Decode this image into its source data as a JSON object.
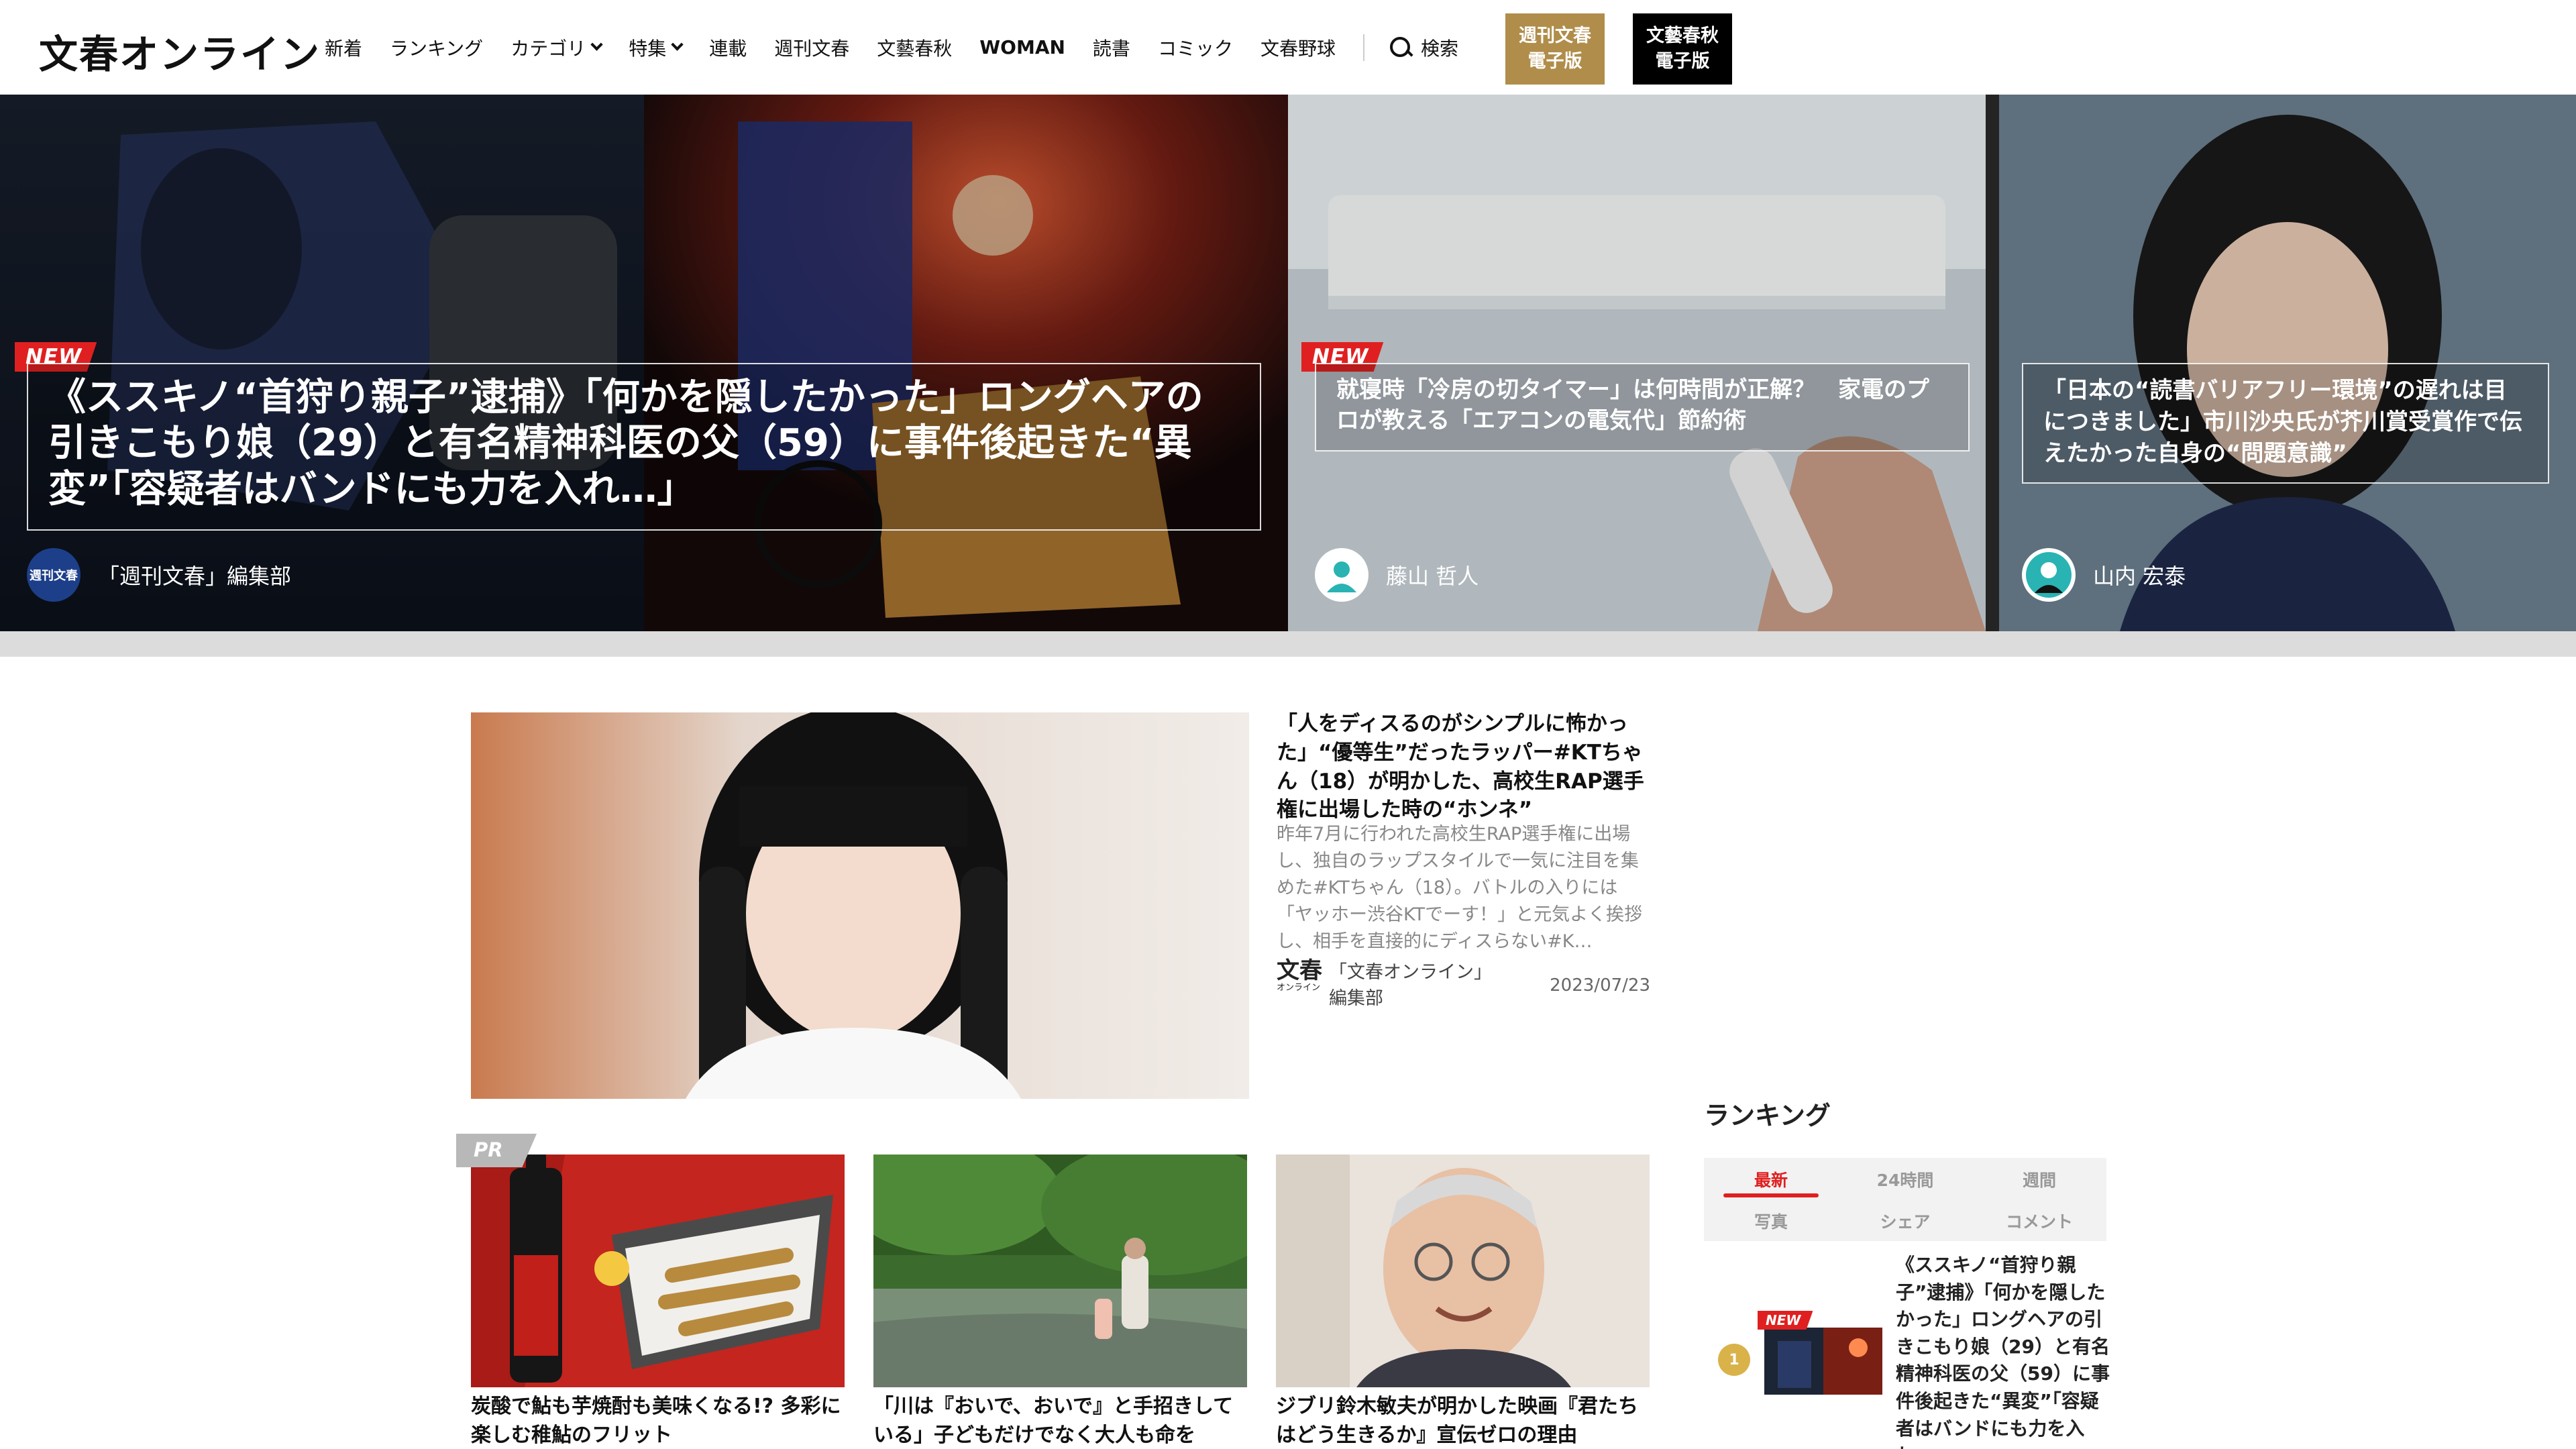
{
  "header": {
    "logo": "文春オンライン",
    "nav": [
      {
        "label": "新着"
      },
      {
        "label": "ランキング"
      },
      {
        "label": "カテゴリ"
      },
      {
        "label": "特集"
      },
      {
        "label": "連載"
      },
      {
        "label": "週刊文春"
      },
      {
        "label": "文藝春秋"
      },
      {
        "label": "WOMAN"
      },
      {
        "label": "読書"
      },
      {
        "label": "コミック"
      },
      {
        "label": "文春野球"
      }
    ],
    "search_label": "検索",
    "weekly_button": "週刊文春\n電子版",
    "bunshun_button": "文藝春秋\n電子版"
  },
  "hero": {
    "new_label": "NEW",
    "main": {
      "title": "《ススキノ“首狩り親子”逮捕》「何かを隠したかった」ロングヘアの引きこもり娘（29）と有名精神科医の父（59）に事件後起きた“異変”「容疑者はバンドにも力を入れ…」",
      "author": "「週刊文春」編集部",
      "avatar_text": "週刊文春"
    },
    "second": {
      "title": "就寝時「冷房の切タイマー」は何時間が正解？　家電のプロが教える「エアコンの電気代」節約術",
      "author": "藤山 哲人"
    },
    "third": {
      "title": "「日本の“読書バリアフリー環境”の遅れは目につきました」市川沙央氏が芥川賞受賞作で伝えたかった自身の“問題意識”",
      "author": "山内 宏泰"
    }
  },
  "feature": {
    "title": "「人をディスるのがシンプルに怖かった」“優等生”だったラッパー#KTちゃん（18）が明かした、高校生RAP選手権に出場した時の“ホンネ”",
    "description": "昨年7月に行われた高校生RAP選手権に出場し、独自のラップスタイルで一気に注目を集めた#KTちゃん（18）。バトルの入りには「ヤッホー渋谷KTでーす！」と元気よく挨拶し、相手を直接的にディスらない#K…",
    "source_logo": "文春",
    "source_logo_sub": "オンライン",
    "author": "「文春オンライン」編集部",
    "date": "2023/07/23"
  },
  "cards": [
    {
      "badge": "PR",
      "title": "炭酸で鮎も芋焼酎も美味くなる!? 多彩に楽しむ稚鮎のフリット"
    },
    {
      "title": "「川は『おいで、おいで』と手招きしている」子どもだけでなく大人も命を"
    },
    {
      "title": "ジブリ鈴木敏夫が明かした映画『君たちはどう生きるか』宣伝ゼロの理由"
    }
  ],
  "ranking": {
    "heading": "ランキング",
    "tabs": [
      "最新",
      "24時間",
      "週間",
      "写真",
      "シェア",
      "コメント"
    ],
    "active_tab": "最新",
    "items": [
      {
        "rank": "1",
        "new_label": "NEW",
        "title": "《ススキノ“首狩り親子”逮捕》「何かを隠したかった」ロングヘアの引きこもり娘（29）と有名精神科医の父（59）に事件後起きた“異変”「容疑者はバンドにも力を入れ…」"
      }
    ]
  },
  "colors": {
    "accent_red": "#e02020",
    "weekly_gold": "#b08d4a",
    "bunshun_black": "#000000",
    "rank_gold": "#d9b24a"
  },
  "icons": {
    "search": "search-icon",
    "chevron": "chevron-down-icon",
    "avatar": "user-avatar-icon"
  }
}
